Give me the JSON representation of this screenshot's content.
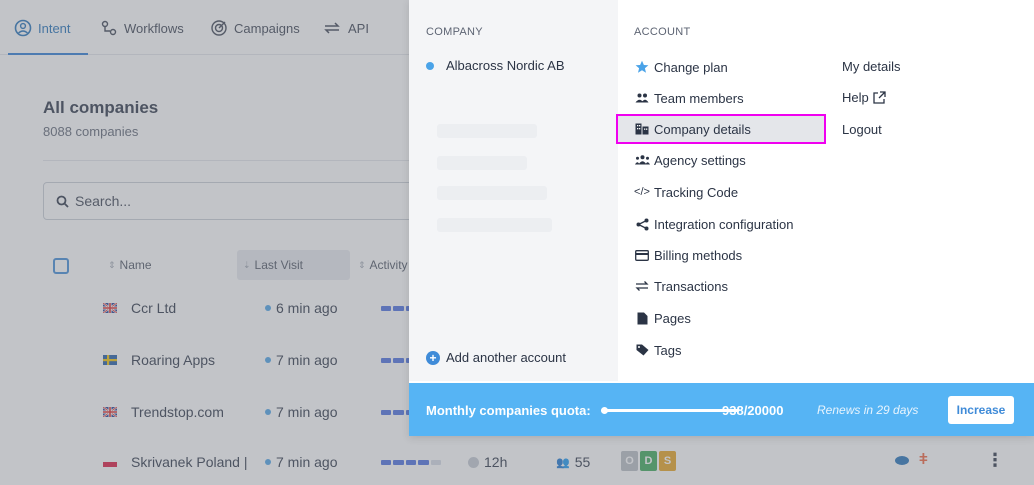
{
  "nav": {
    "tabs": [
      {
        "label": "Intent",
        "icon": "intent-icon"
      },
      {
        "label": "Workflows",
        "icon": "workflows-icon"
      },
      {
        "label": "Campaigns",
        "icon": "campaigns-icon"
      },
      {
        "label": "API",
        "icon": "api-icon"
      }
    ]
  },
  "page": {
    "title": "All companies",
    "subtitle": "8088 companies",
    "search_placeholder": "Search..."
  },
  "table": {
    "headers": {
      "name": "Name",
      "last_visit": "Last Visit",
      "activity": "Activity"
    },
    "rows": [
      {
        "flag": "uk",
        "name": "Ccr Ltd",
        "last_visit": "6 min ago",
        "activity_level": 0.8
      },
      {
        "flag": "se",
        "name": "Roaring Apps",
        "last_visit": "7 min ago",
        "activity_level": 0.8
      },
      {
        "flag": "uk",
        "name": "Trendstop.com",
        "last_visit": "7 min ago",
        "activity_level": 0.8
      },
      {
        "flag": "pl",
        "name": "Skrivanek Poland |",
        "last_visit": "7 min ago",
        "activity_level": 0.8,
        "time": "12h",
        "employees": "55",
        "badges": [
          "O",
          "D",
          "S"
        ]
      }
    ]
  },
  "menu": {
    "company_header": "COMPANY",
    "account_header": "ACCOUNT",
    "current_company": "Albacross Nordic AB",
    "add_account": "Add another account",
    "account_items": [
      {
        "label": "Change plan",
        "icon": "star-icon"
      },
      {
        "label": "Team members",
        "icon": "team-icon"
      },
      {
        "label": "Company details",
        "icon": "building-icon"
      },
      {
        "label": "Agency settings",
        "icon": "agency-icon"
      },
      {
        "label": "Tracking Code",
        "icon": "code-icon"
      },
      {
        "label": "Integration configuration",
        "icon": "share-icon"
      },
      {
        "label": "Billing methods",
        "icon": "credit-card-icon"
      },
      {
        "label": "Transactions",
        "icon": "transactions-icon"
      },
      {
        "label": "Pages",
        "icon": "page-icon"
      },
      {
        "label": "Tags",
        "icon": "tag-icon"
      }
    ],
    "right_links": [
      {
        "label": "My details"
      },
      {
        "label": "Help",
        "icon": "external-link-icon"
      },
      {
        "label": "Logout"
      }
    ]
  },
  "quota": {
    "label": "Monthly companies quota:",
    "count": "938/20000",
    "fill_fraction": 0.047,
    "renew": "Renews in 29 days",
    "button": "Increase"
  },
  "colors": {
    "accent": "#3f8bd8",
    "quota_bar": "#56b4f4",
    "highlight_border": "#f000f0"
  }
}
